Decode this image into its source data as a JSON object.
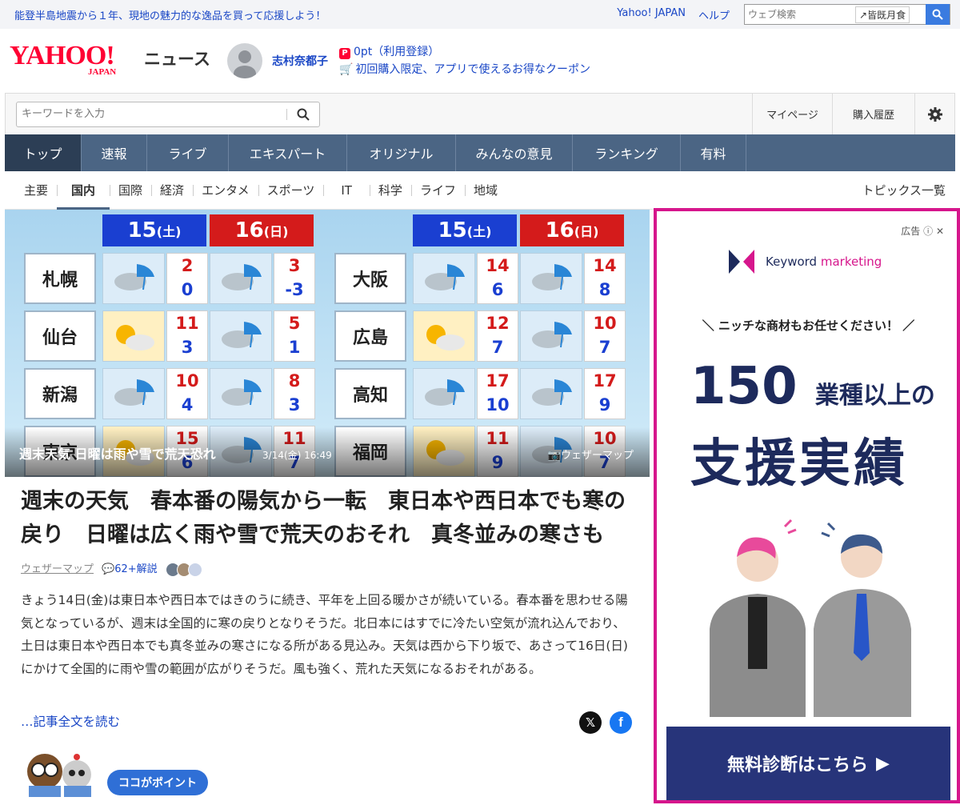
{
  "topbar": {
    "promo": "能登半島地震から１年、現地の魅力的な逸品を買って応援しよう！",
    "link_yahoo": "Yahoo! JAPAN",
    "link_help": "ヘルプ",
    "search_placeholder": "ウェブ検索",
    "suggest": "皆既月食"
  },
  "header": {
    "logo_text": "YAHOO!",
    "logo_sub": "JAPAN",
    "service": "ニュース",
    "username": "志村奈都子",
    "points": "0pt（利用登録）",
    "coupon": "初回購入限定、アプリで使えるお得なクーポン"
  },
  "search": {
    "placeholder": "キーワードを入力",
    "mypage": "マイページ",
    "history": "購入履歴"
  },
  "mainnav": [
    "トップ",
    "速報",
    "ライブ",
    "エキスパート",
    "オリジナル",
    "みんなの意見",
    "ランキング",
    "有料"
  ],
  "subnav": {
    "items": [
      "主要",
      "国内",
      "国際",
      "経済",
      "エンタメ",
      "スポーツ",
      "IT",
      "科学",
      "ライフ",
      "地域"
    ],
    "topics": "トピックス一覧"
  },
  "weather": {
    "day1": "15",
    "day1_dow": "(土)",
    "day2": "16",
    "day2_dow": "(日)",
    "cities": [
      {
        "name": "札幌",
        "d1": [
          "2",
          "0"
        ],
        "d2": [
          "3",
          "-3"
        ]
      },
      {
        "name": "仙台",
        "d1": [
          "11",
          "3"
        ],
        "d2": [
          "5",
          "1"
        ]
      },
      {
        "name": "新潟",
        "d1": [
          "10",
          "4"
        ],
        "d2": [
          "8",
          "3"
        ]
      },
      {
        "name": "東京",
        "d1": [
          "15",
          "6"
        ],
        "d2": [
          "11",
          "7"
        ]
      },
      {
        "name": "大阪",
        "d1": [
          "14",
          "6"
        ],
        "d2": [
          "14",
          "8"
        ]
      },
      {
        "name": "広島",
        "d1": [
          "12",
          "7"
        ],
        "d2": [
          "10",
          "7"
        ]
      },
      {
        "name": "高知",
        "d1": [
          "17",
          "10"
        ],
        "d2": [
          "17",
          "9"
        ]
      },
      {
        "name": "福岡",
        "d1": [
          "11",
          "9"
        ],
        "d2": [
          "10",
          "7"
        ]
      }
    ],
    "caption_title": "週末天気 日曜は雨や雪で荒天恐れ",
    "caption_date": "3/14(金) 16:49",
    "caption_source": "ウェザーマップ"
  },
  "article": {
    "headline": "週末の天気　春本番の陽気から一転　東日本や西日本でも寒の戻り　日曜は広く雨や雪で荒天のおそれ　真冬並みの寒さも",
    "source": "ウェザーマップ",
    "comments": "62+解説",
    "summary": "きょう14日(金)は東日本や西日本ではきのうに続き、平年を上回る暖かさが続いている。春本番を思わせる陽気となっているが、週末は全国的に寒の戻りとなりそうだ。北日本にはすでに冷たい空気が流れ込んでおり、土日は東日本や西日本でも真冬並みの寒さになる所がある見込み。天気は西から下り坂で、あさって16日(日)にかけて全国的に雨や雪の範囲が広がりそうだ。風も強く、荒れた天気になるおそれがある。",
    "readmore": "…記事全文を読む",
    "point_label": "ココがポイント"
  },
  "ad": {
    "label": "広告",
    "brand_a": "Keyword",
    "brand_b": "marketing",
    "tagline": "＼ ニッチな商材もお任せください！ ／",
    "big_num": "150",
    "big_suffix": "業種以上の",
    "big_line2": "支援実績",
    "cta": "無料診断はこちら"
  },
  "colors": {
    "nav_bg": "#4b6584",
    "ad_border": "#d6168c",
    "ad_navy": "#1d2a5c",
    "link": "#1a47c6"
  }
}
